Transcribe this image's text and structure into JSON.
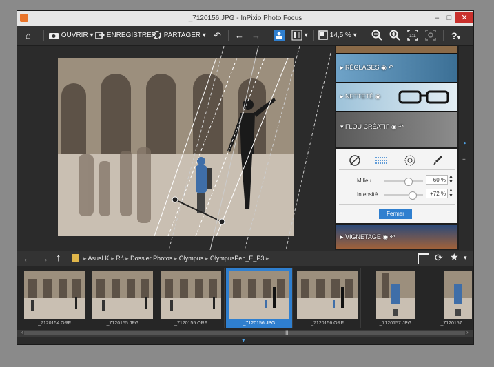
{
  "window": {
    "title": "_7120156.JPG - InPixio Photo Focus",
    "minimize": "–",
    "maximize": "□",
    "close": "✕"
  },
  "toolbar": {
    "home_glyph": "⌂",
    "open_label": "OUVRIR",
    "save_label": "ENREGISTRER",
    "share_label": "PARTAGER",
    "zoom_value": "14,5 %",
    "dropdown": "▾",
    "undo": "↶",
    "back": "←",
    "forward": "→",
    "help": "?"
  },
  "panels": {
    "reglages": "RÉGLAGES",
    "nettete": "NETTETÉ",
    "flou": "FLOU CRÉATIF",
    "vignetage": "VIGNETAGE"
  },
  "flou": {
    "milieu_label": "Milieu",
    "milieu_value": "60 %",
    "milieu_level": 0.6,
    "intensite_label": "Intensité",
    "intensite_value": "+72 %",
    "intensite_level": 0.72,
    "close_label": "Fermer"
  },
  "breadcrumb": [
    "AsusLK",
    "R:\\",
    "Dossier Photos",
    "Olympus",
    "OlympusPen_E_P3"
  ],
  "thumbnails": [
    {
      "name": "_7120154.ORF"
    },
    {
      "name": "_7120155.JPG"
    },
    {
      "name": "_7120155.ORF"
    },
    {
      "name": "_7120156.JPG"
    },
    {
      "name": "_7120156.ORF"
    },
    {
      "name": "_7120157.JPG"
    },
    {
      "name": "_7120157."
    }
  ],
  "colors": {
    "accent": "#2f7fcf",
    "close": "#c9302c"
  }
}
